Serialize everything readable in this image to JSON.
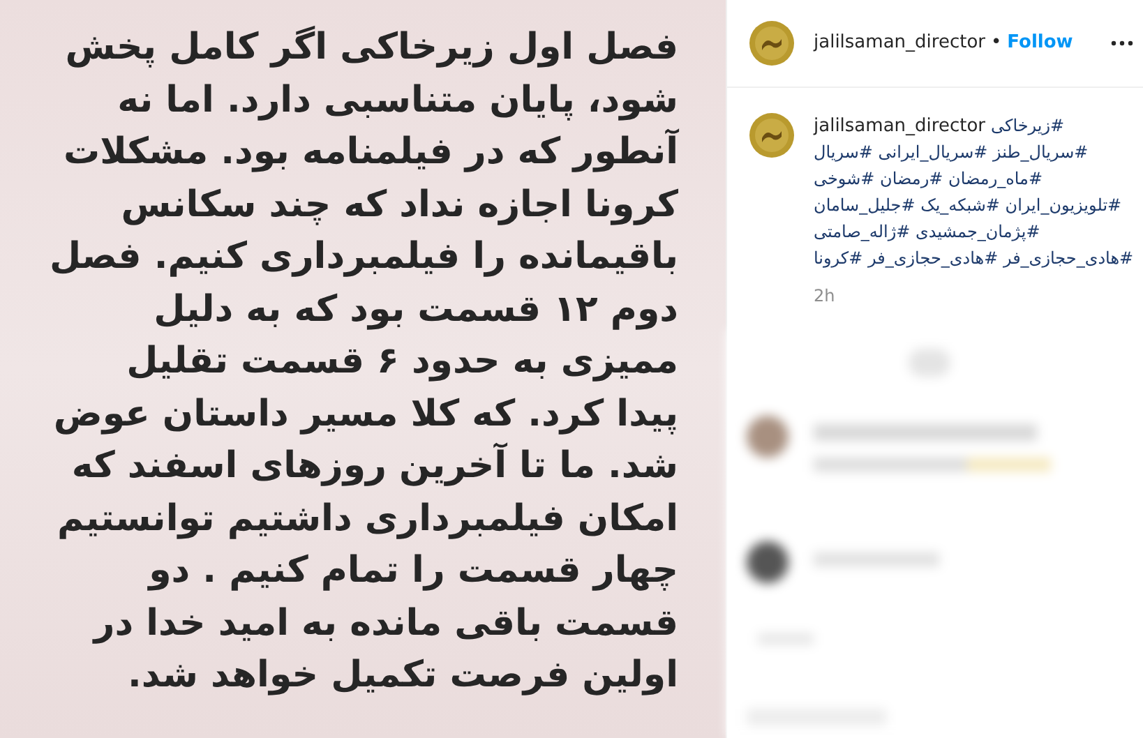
{
  "post_image": {
    "lines": [
      "فصل اول زیرخاکی اگر کامل پخش",
      "شود، پایان متناسبی دارد. اما نه",
      "آنطور که در فیلمنامه بود. مشکلات",
      "کرونا اجازه نداد که چند سکانس",
      "باقیمانده را فیلمبرداری کنیم. فصل",
      "دوم ۱۲ قسمت بود که به دلیل",
      "ممیزی به حدود ۶ قسمت تقلیل",
      "پیدا کرد. که کلا مسیر داستان عوض",
      "شد. ما تا آخرین روزهای اسفند که",
      "امکان فیلمبرداری داشتیم توانستیم",
      "چهار قسمت را تمام کنیم . دو",
      "قسمت باقی مانده به امید خدا در",
      "اولین فرصت تکمیل خواهد شد."
    ]
  },
  "header": {
    "username": "jalilsaman_director",
    "separator": "•",
    "follow": "Follow"
  },
  "caption": {
    "username": "jalilsaman_director",
    "lines": [
      "#زیرخاکی",
      "#سریال_طنز #سریال_ایرانی #سریال",
      "#ماه_رمضان #رمضان #شوخی",
      "#تلویزیون_ایران #شبکه_یک #جلیل_سامان",
      "#پژمان_جمشیدی #ژاله_صامتی",
      "#هادی_حجازی_فر #هادی_حجازی_فر #کرونا"
    ],
    "time": "2h"
  }
}
